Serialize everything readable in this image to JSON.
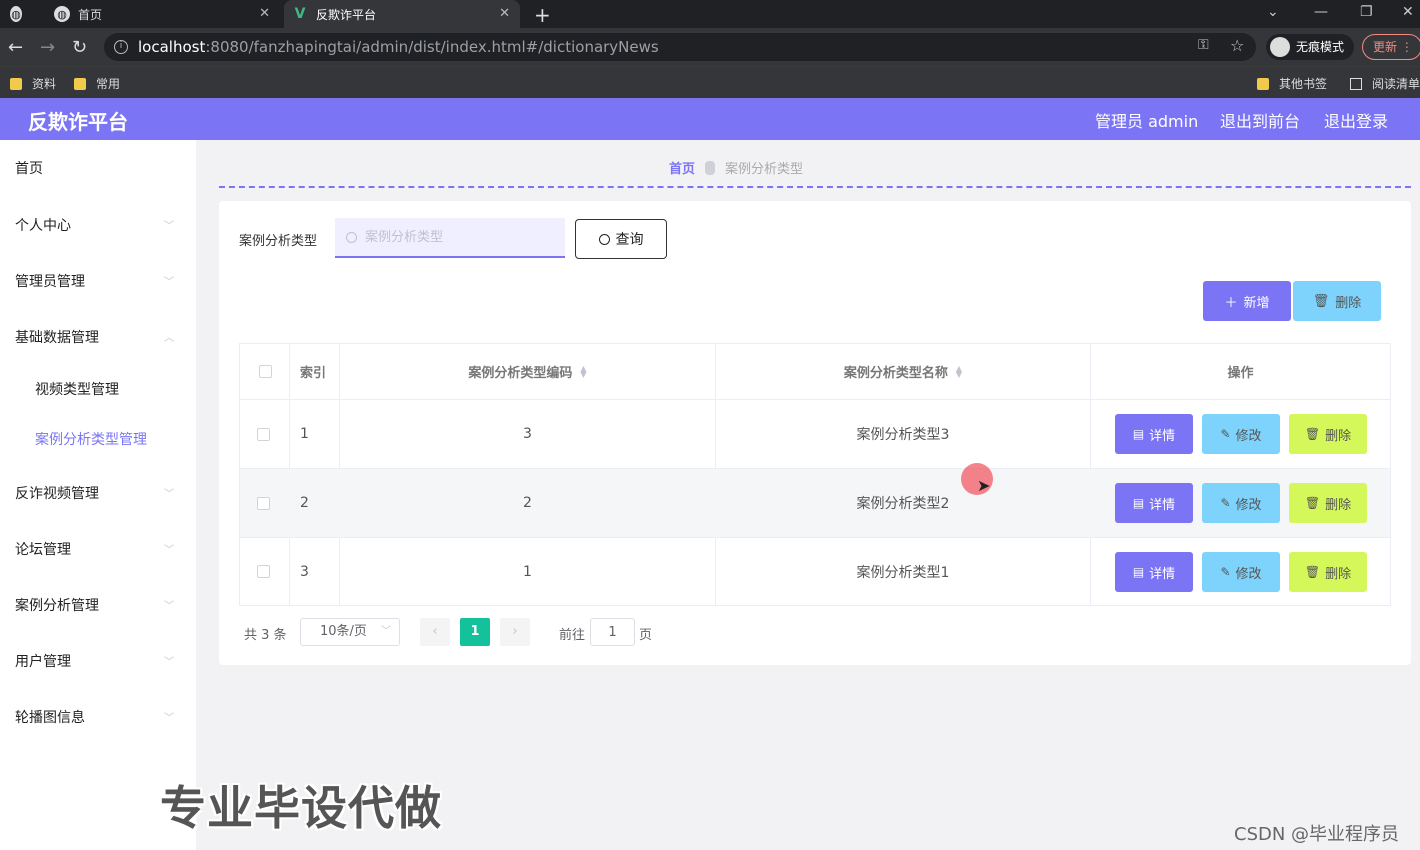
{
  "browser": {
    "tabs": [
      {
        "label": ""
      },
      {
        "label": "首页"
      },
      {
        "label": "反欺诈平台"
      }
    ],
    "url_host": "localhost",
    "url_rest": ":8080/fanzhapingtai/admin/dist/index.html#/dictionaryNews",
    "incognito_label": "无痕模式",
    "update_label": "更新",
    "bookmarks": [
      "资料",
      "常用"
    ],
    "bookmarks_right": [
      "其他书签",
      "阅读清单"
    ]
  },
  "header": {
    "title": "反欺诈平台",
    "user": "管理员 admin",
    "to_front": "退出到前台",
    "logout": "退出登录"
  },
  "sidebar": {
    "items": [
      {
        "label": "首页"
      },
      {
        "label": "个人中心"
      },
      {
        "label": "管理员管理"
      },
      {
        "label": "基础数据管理"
      },
      {
        "label": "视频类型管理"
      },
      {
        "label": "案例分析类型管理"
      },
      {
        "label": "反诈视频管理"
      },
      {
        "label": "论坛管理"
      },
      {
        "label": "案例分析管理"
      },
      {
        "label": "用户管理"
      },
      {
        "label": "轮播图信息"
      }
    ]
  },
  "breadcrumb": {
    "home": "首页",
    "current": "案例分析类型"
  },
  "search": {
    "label": "案例分析类型",
    "placeholder": "案例分析类型",
    "value": "",
    "button": "查询"
  },
  "toolbar": {
    "add": "新增",
    "delete": "删除"
  },
  "table": {
    "headers": [
      "索引",
      "案例分析类型编码",
      "案例分析类型名称",
      "操作"
    ],
    "rows": [
      {
        "index": "1",
        "code": "3",
        "name": "案例分析类型3"
      },
      {
        "index": "2",
        "code": "2",
        "name": "案例分析类型2"
      },
      {
        "index": "3",
        "code": "1",
        "name": "案例分析类型1"
      }
    ],
    "actions": {
      "detail": "详情",
      "edit": "修改",
      "delete": "删除"
    }
  },
  "pagination": {
    "total": "共 3 条",
    "page_size": "10条/页",
    "current": "1",
    "goto_label": "前往",
    "goto_value": "1",
    "page_label": "页"
  },
  "watermarks": {
    "big": "专业毕设代做",
    "csdn": "CSDN @毕业程序员"
  },
  "colors": {
    "accent": "#7b75f5",
    "info": "#7dd3fc",
    "warning": "#d4f75a",
    "pager_active": "#13c29b"
  }
}
